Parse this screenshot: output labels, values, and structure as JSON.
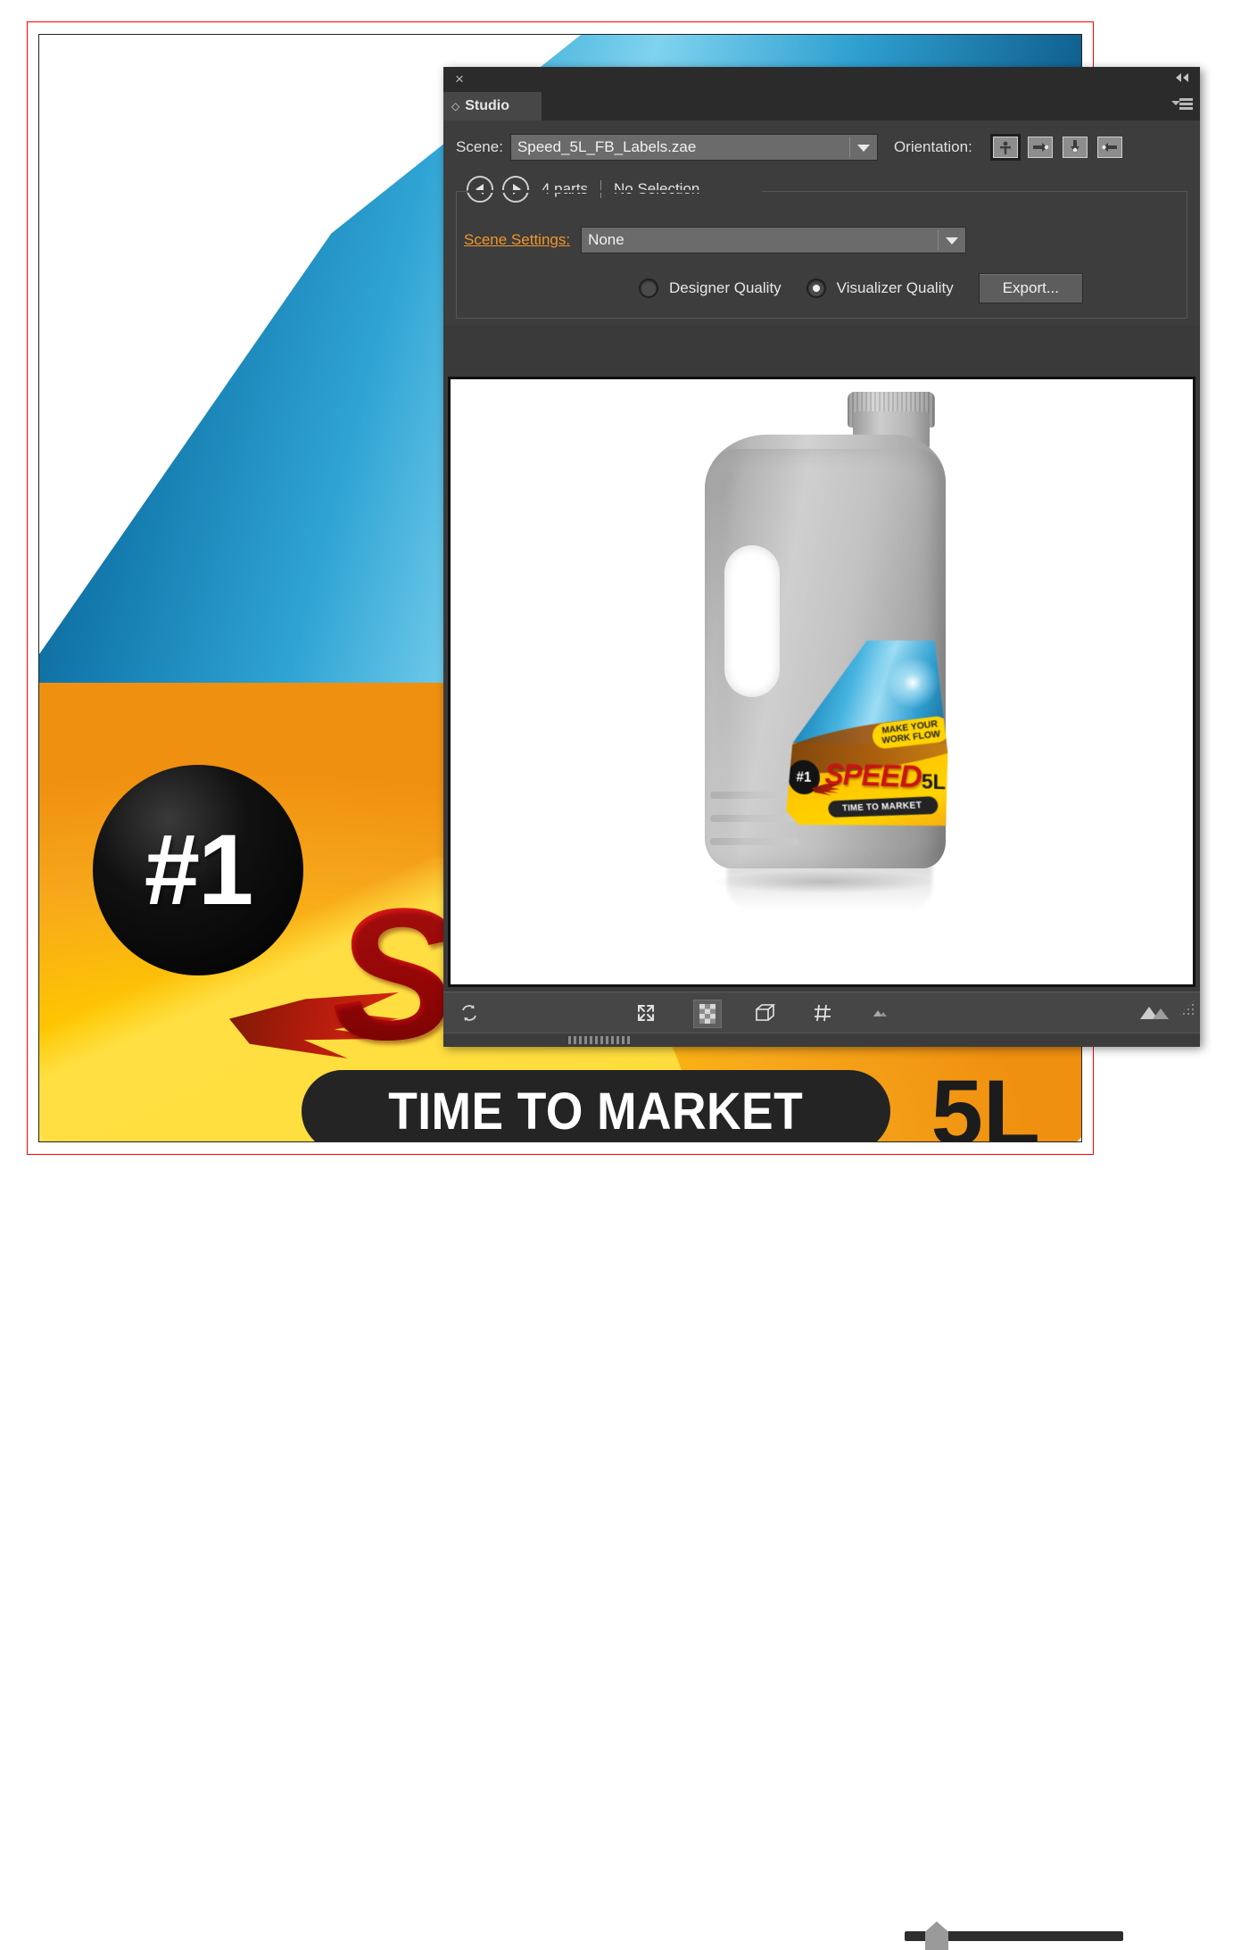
{
  "artwork": {
    "badge_number": "#1",
    "brand": "SPEED",
    "tagline": "TIME TO MARKET",
    "volume": "5L",
    "promo_line1": "MAKE YOUR",
    "promo_line2": "WORK FLOW",
    "colors": {
      "artboard_guide": "#ff0000",
      "blue": "#2fa4d4",
      "yellow": "#ffd400",
      "red": "#cc1111",
      "black": "#242424"
    }
  },
  "panel": {
    "title": "Studio",
    "close_icon": "×",
    "collapse_icon": "◀◀",
    "menu_icon": "panel-menu-icon",
    "tab_diamond": "◇"
  },
  "scene": {
    "label": "Scene:",
    "value": "Speed_5L_FB_Labels.zae",
    "dropdown_arrow": "▼"
  },
  "orientation": {
    "label": "Orientation:",
    "buttons": [
      {
        "name": "orientation-front",
        "selected": true
      },
      {
        "name": "orientation-right",
        "selected": false
      },
      {
        "name": "orientation-top",
        "selected": false
      },
      {
        "name": "orientation-left",
        "selected": false
      }
    ]
  },
  "parts_bar": {
    "prev_icon": "◀",
    "next_icon": "▶",
    "parts_count": "4 parts",
    "selection": "No Selection"
  },
  "scene_settings": {
    "label": "Scene Settings:",
    "value": "None",
    "dropdown_arrow": "▼"
  },
  "quality": {
    "designer_label": "Designer Quality",
    "designer_selected": false,
    "visualizer_label": "Visualizer Quality",
    "visualizer_selected": true,
    "export_label": "Export...",
    "accent_color": "#f0952a"
  },
  "viewport_toolbar": {
    "items": [
      {
        "name": "refresh-icon",
        "glyph": "⟳"
      },
      {
        "name": "fit-to-screen-icon",
        "glyph": "fit"
      },
      {
        "name": "transparency-checker-icon",
        "glyph": "checker"
      },
      {
        "name": "bounding-box-icon",
        "glyph": "cube"
      },
      {
        "name": "grid-icon",
        "glyph": "grid"
      },
      {
        "name": "quality-low-icon",
        "glyph": "small-mountain"
      },
      {
        "name": "quality-slider",
        "glyph": "slider"
      },
      {
        "name": "quality-high-icon",
        "glyph": "large-mountain"
      }
    ],
    "slider_value": 12
  }
}
